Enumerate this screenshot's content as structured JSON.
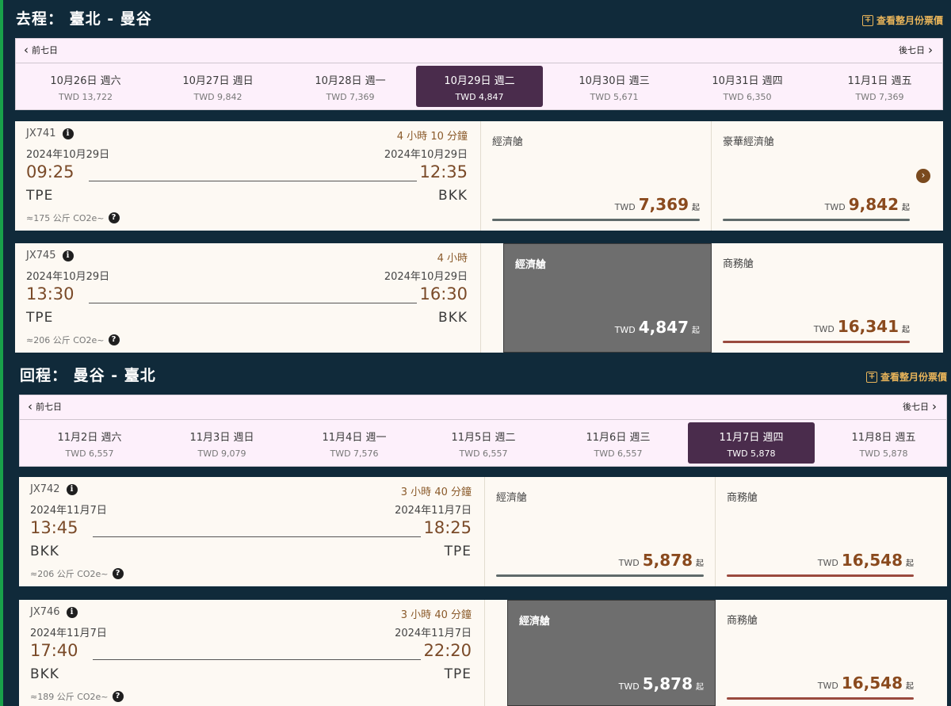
{
  "outbound": {
    "title": "去程： 臺北 - 曼谷",
    "month_link": "查看整月份票價",
    "prev_label": "前七日",
    "next_label": "後七日",
    "dates": [
      {
        "label": "10月26日 週六",
        "price": "TWD 13,722",
        "selected": false
      },
      {
        "label": "10月27日 週日",
        "price": "TWD 9,842",
        "selected": false
      },
      {
        "label": "10月28日 週一",
        "price": "TWD 7,369",
        "selected": false
      },
      {
        "label": "10月29日 週二",
        "price": "TWD 4,847",
        "selected": true
      },
      {
        "label": "10月30日 週三",
        "price": "TWD 5,671",
        "selected": false
      },
      {
        "label": "10月31日 週四",
        "price": "TWD 6,350",
        "selected": false
      },
      {
        "label": "11月1日 週五",
        "price": "TWD 7,369",
        "selected": false
      }
    ],
    "flights": [
      {
        "number": "JX741",
        "duration": "4 小時 10 分鐘",
        "dep_date": "2024年10月29日",
        "arr_date": "2024年10月29日",
        "dep_time": "09:25",
        "arr_time": "12:35",
        "dep_airport": "TPE",
        "arr_airport": "BKK",
        "co2": "≈175 公斤 CO2e~",
        "fares": [
          {
            "cabin": "經濟艙",
            "currency": "TWD",
            "amount": "7,369",
            "suffix": "起",
            "selected": false,
            "bar_color": "#5f6a6a"
          },
          {
            "cabin": "豪華經濟艙",
            "currency": "TWD",
            "amount": "9,842",
            "suffix": "起",
            "selected": false,
            "bar_color": "#5f6a6a"
          }
        ]
      },
      {
        "number": "JX745",
        "duration": "4 小時",
        "dep_date": "2024年10月29日",
        "arr_date": "2024年10月29日",
        "dep_time": "13:30",
        "arr_time": "16:30",
        "dep_airport": "TPE",
        "arr_airport": "BKK",
        "co2": "≈206 公斤 CO2e~",
        "fares": [
          {
            "cabin": "經濟艙",
            "currency": "TWD",
            "amount": "4,847",
            "suffix": "起",
            "selected": true,
            "bar_color": ""
          },
          {
            "cabin": "商務艙",
            "currency": "TWD",
            "amount": "16,341",
            "suffix": "起",
            "selected": false,
            "bar_color": "#9a4a3e"
          }
        ]
      }
    ]
  },
  "inbound": {
    "title": "回程： 曼谷 - 臺北",
    "month_link": "查看整月份票價",
    "prev_label": "前七日",
    "next_label": "後七日",
    "dates": [
      {
        "label": "11月2日 週六",
        "price": "TWD 6,557",
        "selected": false
      },
      {
        "label": "11月3日 週日",
        "price": "TWD 9,079",
        "selected": false
      },
      {
        "label": "11月4日 週一",
        "price": "TWD 7,576",
        "selected": false
      },
      {
        "label": "11月5日 週二",
        "price": "TWD 6,557",
        "selected": false
      },
      {
        "label": "11月6日 週三",
        "price": "TWD 6,557",
        "selected": false
      },
      {
        "label": "11月7日 週四",
        "price": "TWD 5,878",
        "selected": true
      },
      {
        "label": "11月8日 週五",
        "price": "TWD 5,878",
        "selected": false
      }
    ],
    "flights": [
      {
        "number": "JX742",
        "duration": "3 小時 40 分鐘",
        "dep_date": "2024年11月7日",
        "arr_date": "2024年11月7日",
        "dep_time": "13:45",
        "arr_time": "18:25",
        "dep_airport": "BKK",
        "arr_airport": "TPE",
        "co2": "≈206 公斤 CO2e~",
        "fares": [
          {
            "cabin": "經濟艙",
            "currency": "TWD",
            "amount": "5,878",
            "suffix": "起",
            "selected": false,
            "bar_color": "#5f6a6a"
          },
          {
            "cabin": "商務艙",
            "currency": "TWD",
            "amount": "16,548",
            "suffix": "起",
            "selected": false,
            "bar_color": "#9a4a3e"
          }
        ]
      },
      {
        "number": "JX746",
        "duration": "3 小時 40 分鐘",
        "dep_date": "2024年11月7日",
        "arr_date": "2024年11月7日",
        "dep_time": "17:40",
        "arr_time": "22:20",
        "dep_airport": "BKK",
        "arr_airport": "TPE",
        "co2": "≈189 公斤 CO2e~",
        "fares": [
          {
            "cabin": "經濟艙",
            "currency": "TWD",
            "amount": "5,878",
            "suffix": "起",
            "selected": true,
            "bar_color": ""
          },
          {
            "cabin": "商務艙",
            "currency": "TWD",
            "amount": "16,548",
            "suffix": "起",
            "selected": false,
            "bar_color": "#9a4a3e"
          }
        ]
      }
    ]
  }
}
